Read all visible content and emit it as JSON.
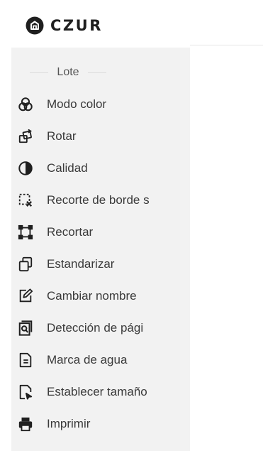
{
  "app": {
    "brand": "CZUR"
  },
  "sidebar": {
    "section_title": "Lote",
    "items": [
      {
        "label": "Modo color",
        "icon": "color-mode-icon"
      },
      {
        "label": "Rotar",
        "icon": "rotate-icon"
      },
      {
        "label": "Calidad",
        "icon": "quality-icon"
      },
      {
        "label": "Recorte de borde s",
        "icon": "edge-crop-icon"
      },
      {
        "label": "Recortar",
        "icon": "crop-icon"
      },
      {
        "label": "Estandarizar",
        "icon": "standardize-icon"
      },
      {
        "label": "Cambiar nombre",
        "icon": "rename-icon"
      },
      {
        "label": "Detección de pági",
        "icon": "page-detection-icon"
      },
      {
        "label": "Marca de agua",
        "icon": "watermark-icon"
      },
      {
        "label": "Establecer tamaño",
        "icon": "set-size-icon"
      },
      {
        "label": "Imprimir",
        "icon": "print-icon"
      }
    ]
  }
}
